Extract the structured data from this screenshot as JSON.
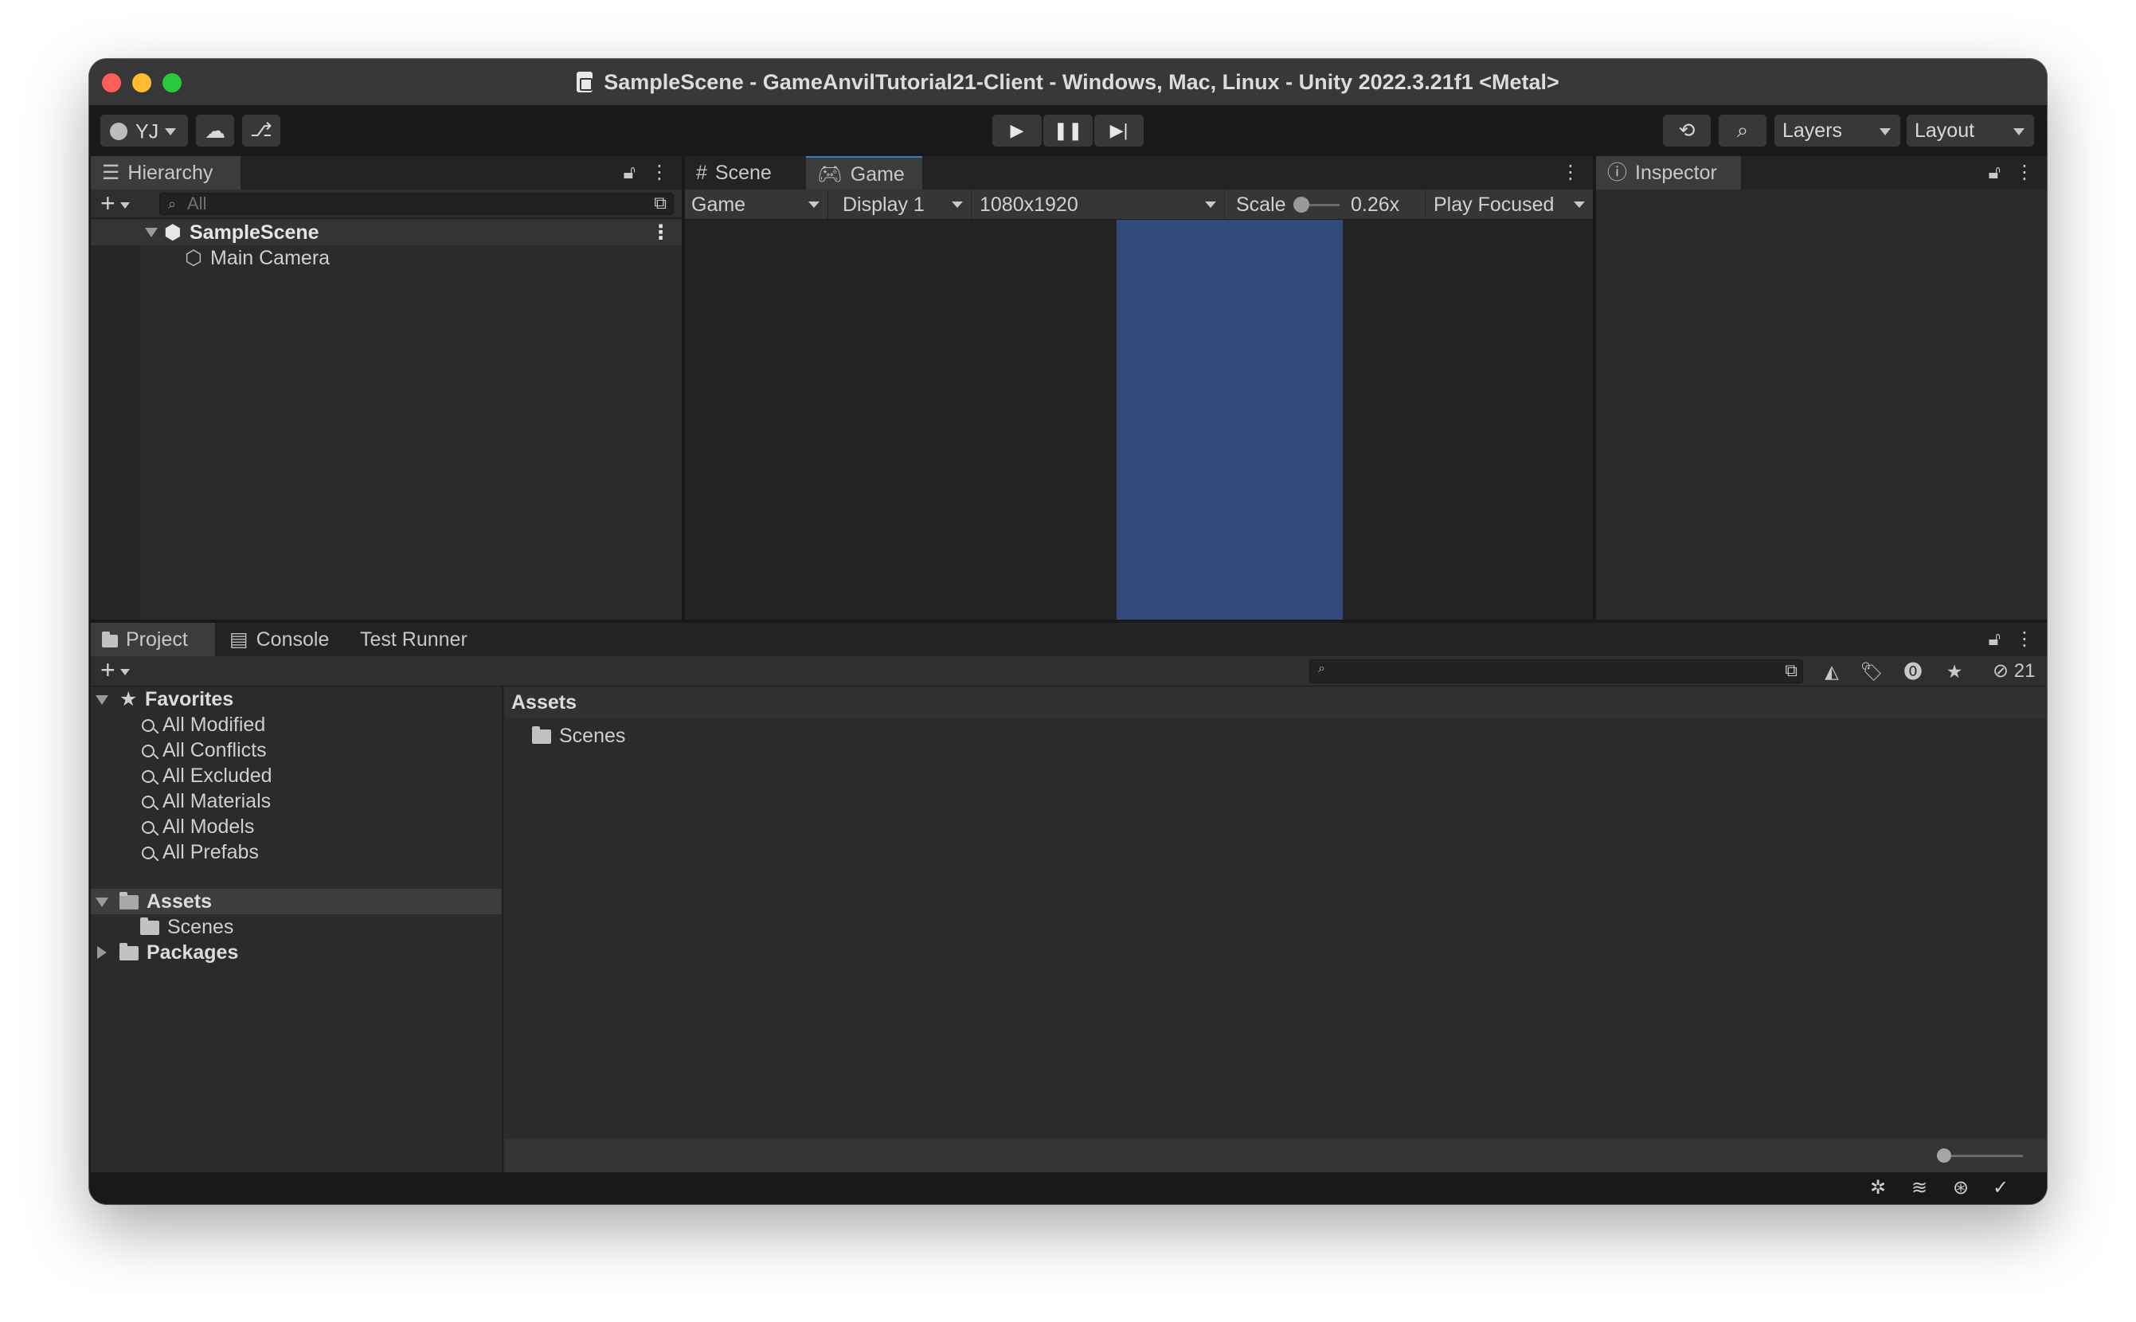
{
  "window": {
    "title": "SampleScene - GameAnvilTutorial21-Client - Windows, Mac, Linux - Unity 2022.3.21f1 <Metal>"
  },
  "toolbar": {
    "account_label": "YJ",
    "layers_label": "Layers",
    "layout_label": "Layout",
    "icons": [
      "account-icon",
      "cloud-icon",
      "collab-icon",
      "play-icon",
      "pause-icon",
      "step-icon",
      "history-icon",
      "search-icon"
    ]
  },
  "hierarchy": {
    "tab_label": "Hierarchy",
    "search_placeholder": "All",
    "scene_name": "SampleScene",
    "objects": [
      {
        "label": "Main Camera"
      }
    ]
  },
  "scene_tab": {
    "label": "Scene"
  },
  "game": {
    "tab_label": "Game",
    "view_dropdown": "Game",
    "display_dropdown": "Display 1",
    "resolution_dropdown": "1080x1920",
    "scale_label": "Scale",
    "scale_value": "0.26x",
    "play_mode_dropdown": "Play Focused",
    "camera_background": "#334b7a"
  },
  "inspector": {
    "tab_label": "Inspector"
  },
  "project": {
    "tabs": [
      {
        "label": "Project"
      },
      {
        "label": "Console"
      },
      {
        "label": "Test Runner"
      }
    ],
    "hidden_count": "21",
    "favorites_label": "Favorites",
    "favorites": [
      {
        "label": "All Modified"
      },
      {
        "label": "All Conflicts"
      },
      {
        "label": "All Excluded"
      },
      {
        "label": "All Materials"
      },
      {
        "label": "All Models"
      },
      {
        "label": "All Prefabs"
      }
    ],
    "assets_label": "Assets",
    "assets_children": [
      {
        "label": "Scenes"
      }
    ],
    "packages_label": "Packages",
    "content_header": "Assets",
    "content_items": [
      {
        "label": "Scenes"
      }
    ]
  }
}
